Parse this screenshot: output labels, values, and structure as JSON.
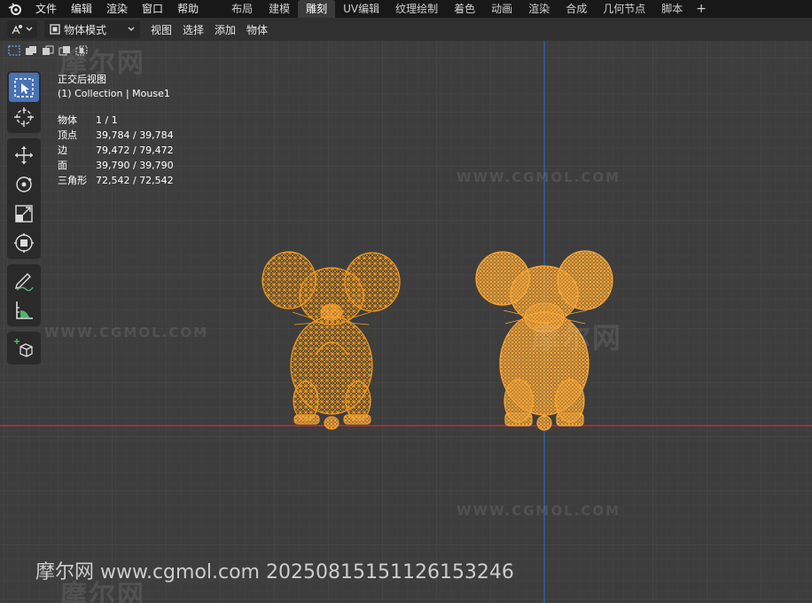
{
  "topbar": {
    "logo_icon": "blender-logo-icon",
    "menus": [
      "文件",
      "编辑",
      "渲染",
      "窗口",
      "帮助"
    ],
    "workspaces": [
      {
        "label": "布局",
        "active": false
      },
      {
        "label": "建模",
        "active": false
      },
      {
        "label": "雕刻",
        "active": true
      },
      {
        "label": "UV编辑",
        "active": false
      },
      {
        "label": "纹理绘制",
        "active": false
      },
      {
        "label": "着色",
        "active": false
      },
      {
        "label": "动画",
        "active": false
      },
      {
        "label": "渲染",
        "active": false
      },
      {
        "label": "合成",
        "active": false
      },
      {
        "label": "几何节点",
        "active": false
      },
      {
        "label": "脚本",
        "active": false
      }
    ],
    "add_label": "+"
  },
  "viewport_header": {
    "mode": "物体模式",
    "menus": [
      "视图",
      "选择",
      "添加",
      "物体"
    ]
  },
  "overlay": {
    "view_title": "正交后视图",
    "collection": "(1) Collection | Mouse1",
    "stats": [
      {
        "label": "物体",
        "value": "1 / 1"
      },
      {
        "label": "顶点",
        "value": "39,784 / 39,784"
      },
      {
        "label": "边",
        "value": "79,472 / 79,472"
      },
      {
        "label": "面",
        "value": "39,790 / 39,790"
      },
      {
        "label": "三角形",
        "value": "72,542 / 72,542"
      }
    ]
  },
  "toolbar": {
    "tools": [
      "select-box-icon",
      "cursor-icon",
      "move-icon",
      "rotate-icon",
      "scale-icon",
      "transform-icon",
      "annotate-icon",
      "measure-icon",
      "add-cube-icon"
    ]
  },
  "watermarks": {
    "site": "WWW.CGMOL.COM",
    "brand": "摩尔网"
  },
  "footer_watermark": "摩尔网 www.cgmol.com 20250815151126153246",
  "colors": {
    "wire": "#f39a1e",
    "axis_x": "#b8303e",
    "axis_z": "#2c5fa8",
    "active_tool": "#4772b3",
    "viewport_bg": "#3d3d3d"
  }
}
